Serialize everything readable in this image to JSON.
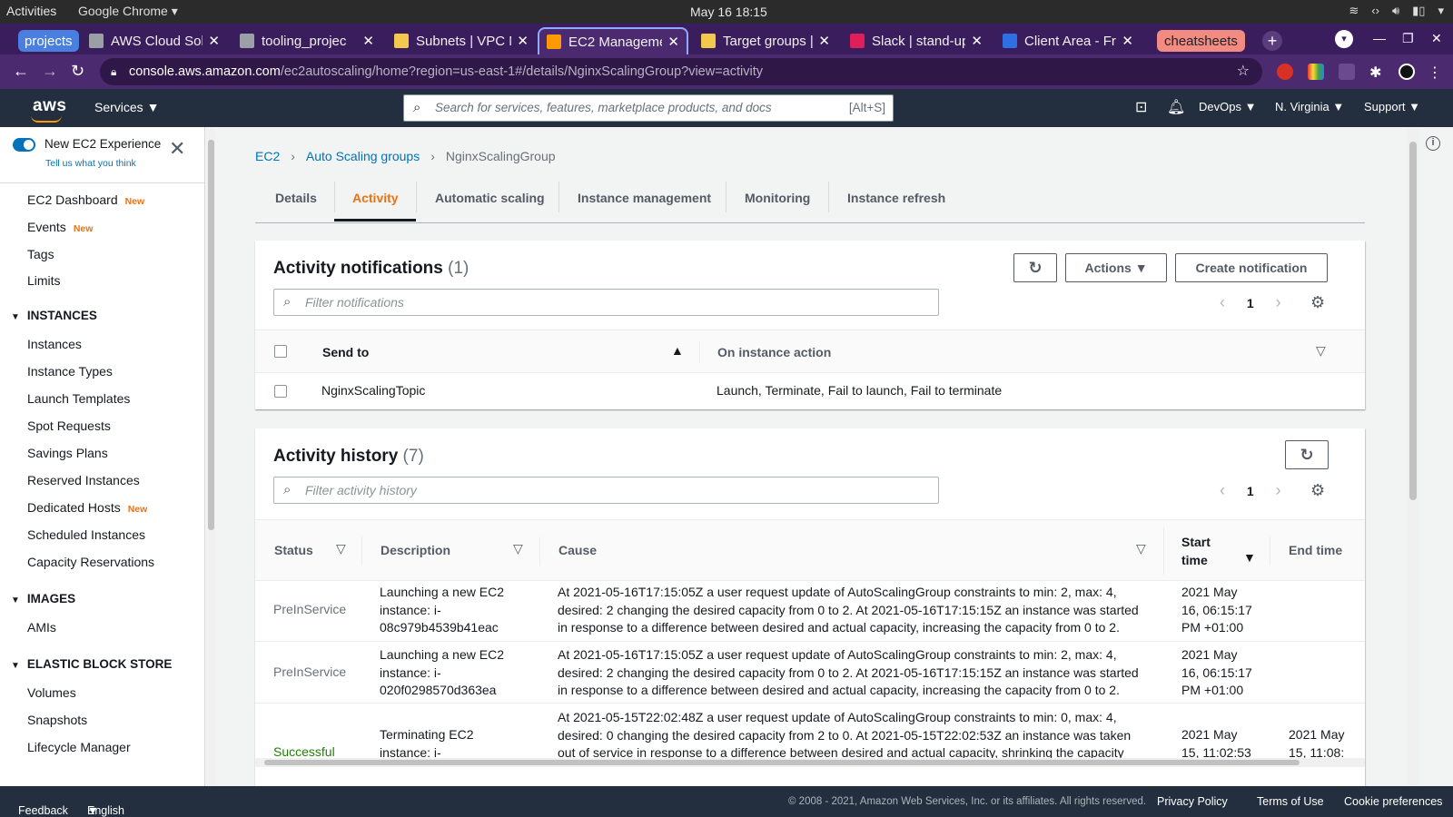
{
  "gnome": {
    "activities": "Activities",
    "app": "Google Chrome ▾",
    "clock": "May 16  18:15"
  },
  "tabs": [
    {
      "label": "projects"
    },
    {
      "label": "AWS Cloud Sol"
    },
    {
      "label": "tooling_projec"
    },
    {
      "label": "Subnets | VPC M"
    },
    {
      "label": "EC2 Manageme"
    },
    {
      "label": "Target groups |"
    },
    {
      "label": "Slack | stand-up"
    },
    {
      "label": "Client Area - Fr"
    },
    {
      "label": "cheatsheets"
    }
  ],
  "url": {
    "host": "console.aws.amazon.com",
    "path": "/ec2autoscaling/home?region=us-east-1#/details/NginxScalingGroup?view=activity"
  },
  "aws": {
    "logo": "aws",
    "services": "Services",
    "search_placeholder": "Search for services, features, marketplace products, and docs",
    "search_shortcut": "[Alt+S]",
    "account": "DevOps",
    "region": "N. Virginia",
    "support": "Support"
  },
  "sidebar": {
    "experience_title": "New EC2 Experience",
    "experience_sub": "Tell us what you think",
    "new_badge": "New",
    "top": [
      {
        "label": "EC2 Dashboard",
        "new": true
      },
      {
        "label": "Events",
        "new": true
      },
      {
        "label": "Tags",
        "new": false
      },
      {
        "label": "Limits",
        "new": false
      }
    ],
    "instances_header": "INSTANCES",
    "instances": [
      "Instances",
      "Instance Types",
      "Launch Templates",
      "Spot Requests",
      "Savings Plans",
      "Reserved Instances",
      "Dedicated Hosts",
      "Scheduled Instances",
      "Capacity Reservations"
    ],
    "images_header": "IMAGES",
    "images": [
      "AMIs"
    ],
    "ebs_header": "ELASTIC BLOCK STORE",
    "ebs": [
      "Volumes",
      "Snapshots",
      "Lifecycle Manager"
    ]
  },
  "breadcrumb": [
    "EC2",
    "Auto Scaling groups",
    "NginxScalingGroup"
  ],
  "detail_tabs": [
    "Details",
    "Activity",
    "Automatic scaling",
    "Instance management",
    "Monitoring",
    "Instance refresh"
  ],
  "notifications": {
    "title": "Activity notifications",
    "count": "(1)",
    "actions": "Actions",
    "create": "Create notification",
    "filter_placeholder": "Filter notifications",
    "page": "1",
    "col_send": "Send to",
    "col_action": "On instance action",
    "rows": [
      {
        "send_to": "NginxScalingTopic",
        "action": "Launch, Terminate, Fail to launch, Fail to terminate"
      }
    ]
  },
  "history": {
    "title": "Activity history",
    "count": "(7)",
    "filter_placeholder": "Filter activity history",
    "page": "1",
    "cols": {
      "status": "Status",
      "description": "Description",
      "cause": "Cause",
      "start1": "Start",
      "start2": "time",
      "end": "End time"
    },
    "rows": [
      {
        "status": "PreInService",
        "desc": [
          "Launching a new EC2",
          "instance: i-",
          "08c979b4539b41eac"
        ],
        "cause": [
          "At 2021-05-16T17:15:05Z a user request update of AutoScalingGroup constraints to min: 2, max: 4,",
          "desired: 2 changing the desired capacity from 0 to 2. At 2021-05-16T17:15:15Z an instance was started",
          "in response to a difference between desired and actual capacity, increasing the capacity from 0 to 2."
        ],
        "start": [
          "2021 May",
          "16, 06:15:17",
          "PM +01:00"
        ],
        "end": []
      },
      {
        "status": "PreInService",
        "desc": [
          "Launching a new EC2",
          "instance: i-",
          "020f0298570d363ea"
        ],
        "cause": [
          "At 2021-05-16T17:15:05Z a user request update of AutoScalingGroup constraints to min: 2, max: 4,",
          "desired: 2 changing the desired capacity from 0 to 2. At 2021-05-16T17:15:15Z an instance was started",
          "in response to a difference between desired and actual capacity, increasing the capacity from 0 to 2."
        ],
        "start": [
          "2021 May",
          "16, 06:15:17",
          "PM +01:00"
        ],
        "end": []
      },
      {
        "status": "Successful",
        "desc": [
          "Terminating EC2",
          "instance: i-"
        ],
        "cause": [
          "At 2021-05-15T22:02:48Z a user request update of AutoScalingGroup constraints to min: 0, max: 4,",
          "desired: 0 changing the desired capacity from 2 to 0. At 2021-05-15T22:02:53Z an instance was taken",
          "out of service in response to a difference between desired and actual capacity, shrinking the capacity"
        ],
        "start": [
          "2021 May",
          "15, 11:02:53"
        ],
        "end": [
          "2021 May",
          "15, 11:08:"
        ]
      }
    ]
  },
  "footer": {
    "feedback": "Feedback",
    "language": "English (US)",
    "copyright": "© 2008 - 2021, Amazon Web Services, Inc. or its affiliates. All rights reserved.",
    "privacy": "Privacy Policy",
    "terms": "Terms of Use",
    "cookies": "Cookie preferences"
  }
}
